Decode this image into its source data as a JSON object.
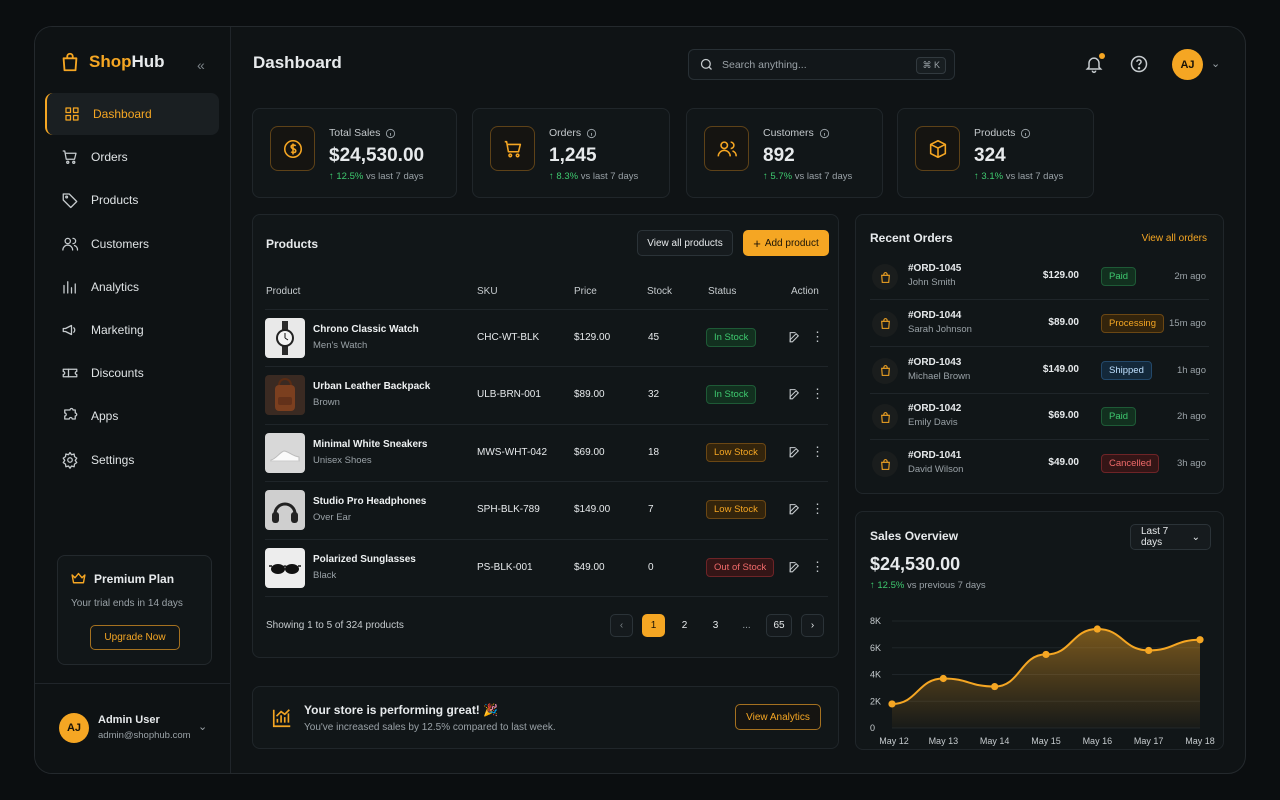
{
  "app": {
    "brand_a": "Shop",
    "brand_b": "Hub",
    "collapse": "«"
  },
  "sidebar": {
    "items": [
      {
        "label": "Dashboard",
        "icon": "grid-icon",
        "active": true
      },
      {
        "label": "Orders",
        "icon": "cart-icon"
      },
      {
        "label": "Products",
        "icon": "tag-icon"
      },
      {
        "label": "Customers",
        "icon": "users-icon"
      },
      {
        "label": "Analytics",
        "icon": "bar-chart-icon"
      },
      {
        "label": "Marketing",
        "icon": "megaphone-icon"
      },
      {
        "label": "Discounts",
        "icon": "ticket-icon"
      },
      {
        "label": "Apps",
        "icon": "puzzle-icon"
      },
      {
        "label": "Settings",
        "icon": "gear-icon"
      }
    ]
  },
  "plan": {
    "title": "Premium Plan",
    "subtitle": "Your trial ends in 14 days",
    "button": "Upgrade Now"
  },
  "user": {
    "initials": "AJ",
    "name": "Admin User",
    "email": "admin@shophub.com"
  },
  "header": {
    "title": "Dashboard",
    "search_placeholder": "Search anything...",
    "shortcut": "⌘ K",
    "avatar": "AJ"
  },
  "stats": [
    {
      "label": "Total Sales",
      "value": "$24,530.00",
      "delta": "12.5%",
      "delta_note": "vs last 7 days",
      "icon": "dollar-icon"
    },
    {
      "label": "Orders",
      "value": "1,245",
      "delta": "8.3%",
      "delta_note": "vs last 7 days",
      "icon": "cart-icon"
    },
    {
      "label": "Customers",
      "value": "892",
      "delta": "5.7%",
      "delta_note": "vs last 7 days",
      "icon": "users-icon"
    },
    {
      "label": "Products",
      "value": "324",
      "delta": "3.1%",
      "delta_note": "vs last 7 days",
      "icon": "box-icon"
    }
  ],
  "products": {
    "title": "Products",
    "view_all": "View all products",
    "add": "Add product",
    "columns": [
      "Product",
      "SKU",
      "Price",
      "Stock",
      "Status",
      "Action"
    ],
    "rows": [
      {
        "name": "Chrono Classic Watch",
        "sub": "Men's Watch",
        "sku": "CHC-WT-BLK",
        "price": "$129.00",
        "stock": "45",
        "status": "In Stock",
        "kind": "ok",
        "thumb": "watch"
      },
      {
        "name": "Urban Leather Backpack",
        "sub": "Brown",
        "sku": "ULB-BRN-001",
        "price": "$89.00",
        "stock": "32",
        "status": "In Stock",
        "kind": "ok",
        "thumb": "backpack"
      },
      {
        "name": "Minimal White Sneakers",
        "sub": "Unisex Shoes",
        "sku": "MWS-WHT-042",
        "price": "$69.00",
        "stock": "18",
        "status": "Low Stock",
        "kind": "low",
        "thumb": "sneakers"
      },
      {
        "name": "Studio Pro Headphones",
        "sub": "Over Ear",
        "sku": "SPH-BLK-789",
        "price": "$149.00",
        "stock": "7",
        "status": "Low Stock",
        "kind": "low",
        "thumb": "headphones"
      },
      {
        "name": "Polarized Sunglasses",
        "sub": "Black",
        "sku": "PS-BLK-001",
        "price": "$49.00",
        "stock": "0",
        "status": "Out of Stock",
        "kind": "out",
        "thumb": "sunglasses"
      }
    ],
    "showing": "Showing 1 to 5 of 324 products",
    "pages": [
      "1",
      "2",
      "3",
      "...",
      "65"
    ]
  },
  "banner": {
    "title": "Your store is performing great! 🎉",
    "subtitle": "You've increased sales by 12.5% compared to last week.",
    "button": "View Analytics"
  },
  "orders": {
    "title": "Recent Orders",
    "view_all": "View all orders",
    "rows": [
      {
        "id": "#ORD-1045",
        "name": "John Smith",
        "amount": "$129.00",
        "status": "Paid",
        "kind": "ok",
        "time": "2m ago"
      },
      {
        "id": "#ORD-1044",
        "name": "Sarah Johnson",
        "amount": "$89.00",
        "status": "Processing",
        "kind": "low",
        "time": "15m ago"
      },
      {
        "id": "#ORD-1043",
        "name": "Michael Brown",
        "amount": "$149.00",
        "status": "Shipped",
        "kind": "ship",
        "time": "1h ago"
      },
      {
        "id": "#ORD-1042",
        "name": "Emily Davis",
        "amount": "$69.00",
        "status": "Paid",
        "kind": "ok",
        "time": "2h ago"
      },
      {
        "id": "#ORD-1041",
        "name": "David Wilson",
        "amount": "$49.00",
        "status": "Cancelled",
        "kind": "out",
        "time": "3h ago"
      }
    ]
  },
  "sales": {
    "title": "Sales Overview",
    "range": "Last 7 days",
    "value": "$24,530.00",
    "delta": "12.5%",
    "delta_note": "vs previous 7 days"
  },
  "chart_data": {
    "type": "area",
    "categories": [
      "May 12",
      "May 13",
      "May 14",
      "May 15",
      "May 16",
      "May 17",
      "May 18"
    ],
    "values": [
      1800,
      3700,
      3100,
      5500,
      7400,
      5800,
      6600
    ],
    "yticks": [
      "0",
      "2K",
      "4K",
      "6K",
      "8K"
    ],
    "ylim": [
      0,
      8000
    ],
    "color": "#f5a623"
  },
  "colors": {
    "accent": "#f5a623",
    "success": "#3ec96f",
    "danger": "#f06a6a"
  }
}
